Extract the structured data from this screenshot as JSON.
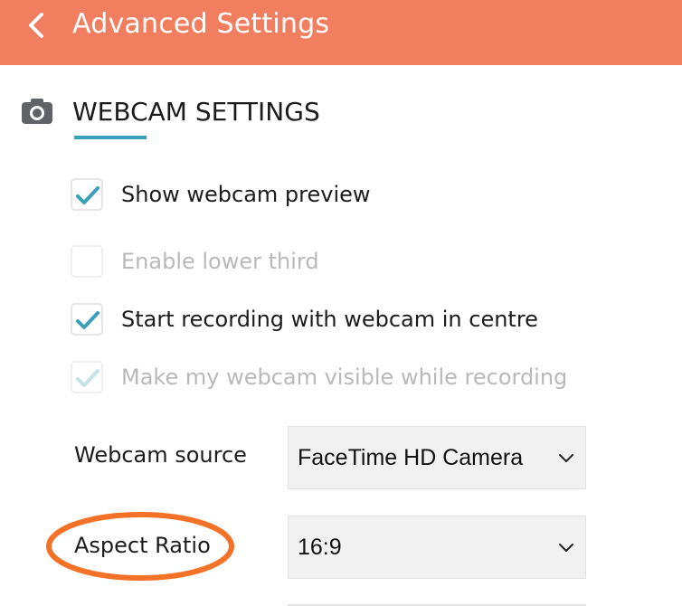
{
  "header": {
    "title": "Advanced Settings",
    "back_icon": "chevron-left-icon",
    "background_color": "#f17f5f"
  },
  "section": {
    "icon": "camera-icon",
    "title": "WEBCAM SETTINGS",
    "accent_color": "#3a9fb8"
  },
  "options": [
    {
      "label": "Show webcam preview",
      "checked": true,
      "disabled": false
    },
    {
      "label": "Enable lower third",
      "checked": false,
      "disabled": true
    },
    {
      "label": "Start recording with webcam in centre",
      "checked": true,
      "disabled": false
    },
    {
      "label": "Make my webcam visible while recording",
      "checked": true,
      "disabled": true
    }
  ],
  "webcam_source": {
    "label": "Webcam source",
    "value": "FaceTime HD Camera"
  },
  "aspect_ratio": {
    "label": "Aspect Ratio",
    "value": "16:9"
  },
  "annotation": {
    "shape": "ellipse",
    "color": "#f47227",
    "target": "Aspect Ratio"
  }
}
